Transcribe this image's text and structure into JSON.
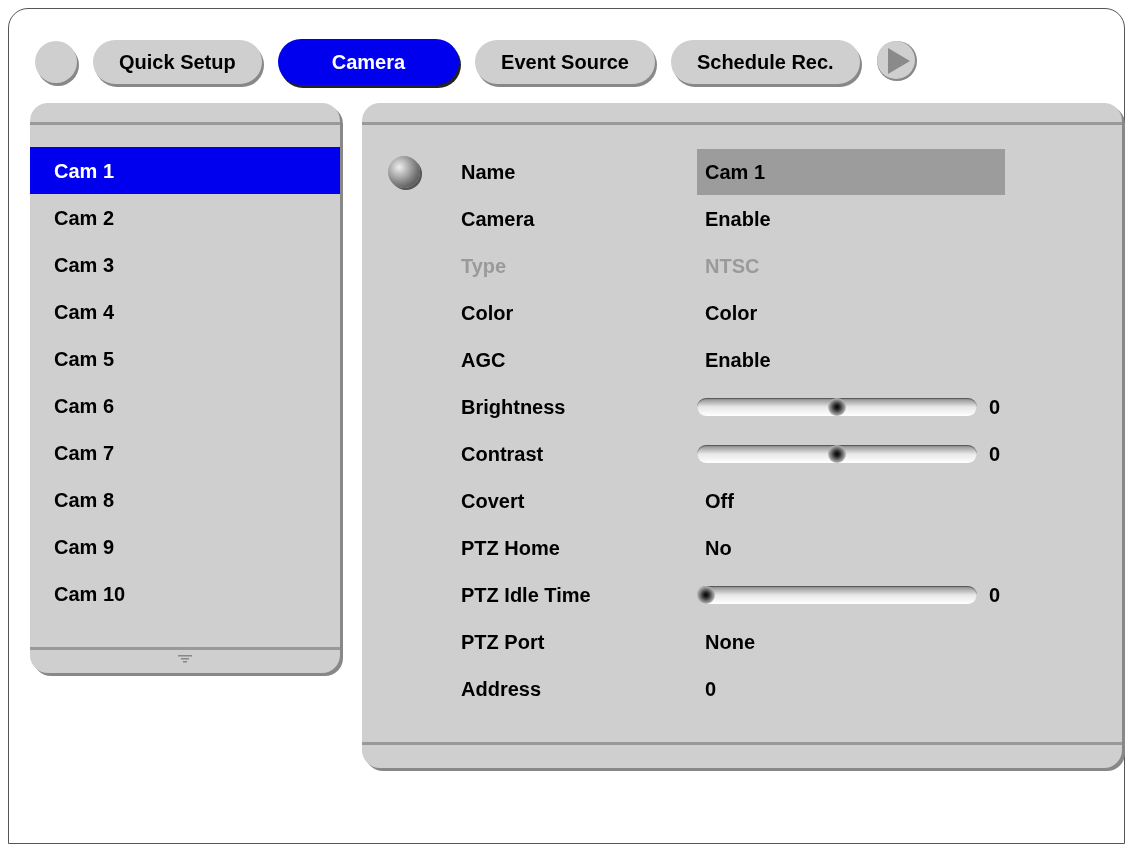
{
  "tabs": [
    {
      "label": "Quick Setup",
      "selected": false
    },
    {
      "label": "Camera",
      "selected": true
    },
    {
      "label": "Event Source",
      "selected": false
    },
    {
      "label": "Schedule Rec.",
      "selected": false
    }
  ],
  "cameras": [
    {
      "label": "Cam 1",
      "selected": true
    },
    {
      "label": "Cam 2",
      "selected": false
    },
    {
      "label": "Cam 3",
      "selected": false
    },
    {
      "label": "Cam 4",
      "selected": false
    },
    {
      "label": "Cam 5",
      "selected": false
    },
    {
      "label": "Cam 6",
      "selected": false
    },
    {
      "label": "Cam 7",
      "selected": false
    },
    {
      "label": "Cam 8",
      "selected": false
    },
    {
      "label": "Cam 9",
      "selected": false
    },
    {
      "label": "Cam 10",
      "selected": false
    }
  ],
  "settings": [
    {
      "kind": "text",
      "label": "Name",
      "value": "Cam 1",
      "selected": true,
      "disabled": false
    },
    {
      "kind": "text",
      "label": "Camera",
      "value": "Enable",
      "selected": false,
      "disabled": false
    },
    {
      "kind": "text",
      "label": "Type",
      "value": "NTSC",
      "selected": false,
      "disabled": true
    },
    {
      "kind": "text",
      "label": "Color",
      "value": "Color",
      "selected": false,
      "disabled": false
    },
    {
      "kind": "text",
      "label": "AGC",
      "value": "Enable",
      "selected": false,
      "disabled": false
    },
    {
      "kind": "slider",
      "label": "Brightness",
      "level": 0.5,
      "value": "0",
      "selected": false,
      "disabled": false
    },
    {
      "kind": "slider",
      "label": "Contrast",
      "level": 0.5,
      "value": "0",
      "selected": false,
      "disabled": false
    },
    {
      "kind": "text",
      "label": "Covert",
      "value": "Off",
      "selected": false,
      "disabled": false
    },
    {
      "kind": "text",
      "label": "PTZ Home",
      "value": "No",
      "selected": false,
      "disabled": false
    },
    {
      "kind": "slider",
      "label": "PTZ Idle Time",
      "level": 0,
      "value": "0",
      "selected": false,
      "disabled": false
    },
    {
      "kind": "text",
      "label": "PTZ Port",
      "value": "None",
      "selected": false,
      "disabled": false
    },
    {
      "kind": "text",
      "label": "Address",
      "value": "0",
      "selected": false,
      "disabled": false
    }
  ]
}
